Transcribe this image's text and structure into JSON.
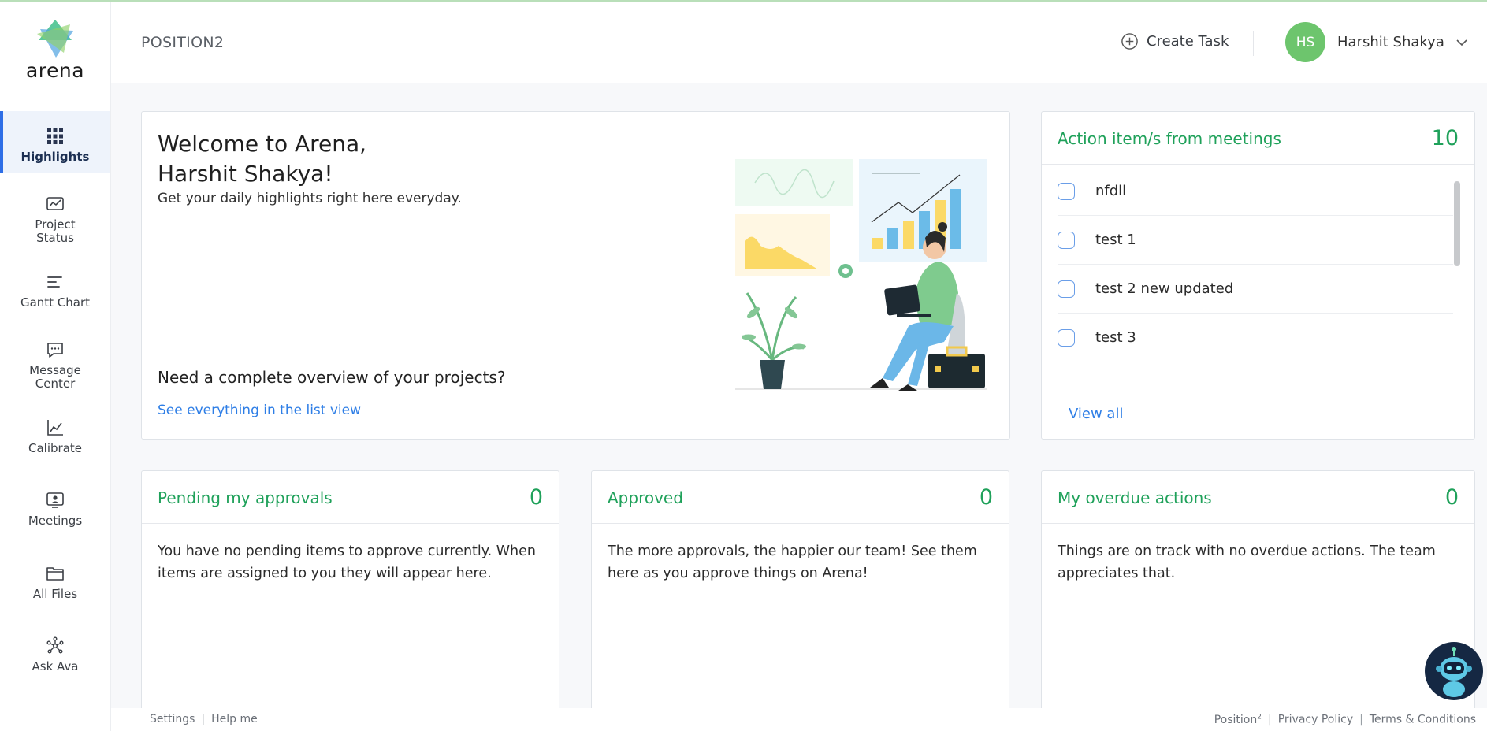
{
  "app": {
    "logo_text": "arena"
  },
  "sidebar": {
    "items": [
      {
        "label": "Highlights",
        "icon": "grid-icon",
        "active": true
      },
      {
        "label": "Project\nStatus",
        "icon": "chart-board-icon"
      },
      {
        "label": "Gantt Chart",
        "icon": "gantt-icon"
      },
      {
        "label": "Message\nCenter",
        "icon": "message-icon"
      },
      {
        "label": "Calibrate",
        "icon": "line-chart-icon"
      },
      {
        "label": "Meetings",
        "icon": "meeting-icon"
      },
      {
        "label": "All Files",
        "icon": "folder-icon"
      },
      {
        "label": "Ask Ava",
        "icon": "network-icon"
      }
    ]
  },
  "header": {
    "title": "POSITION2",
    "create_task": "Create Task",
    "user_initials": "HS",
    "user_name": "Harshit Shakya"
  },
  "welcome": {
    "line1": "Welcome to Arena,",
    "line2": "Harshit Shakya!",
    "subtitle": "Get your daily highlights right here everyday.",
    "question": "Need a complete overview of your projects?",
    "link": "See everything in the list view"
  },
  "action_items": {
    "title": "Action item/s from meetings",
    "count": "10",
    "items": [
      "nfdll",
      "test 1",
      "test 2 new updated",
      "test 3"
    ],
    "view_all": "View all"
  },
  "pending": {
    "title": "Pending my approvals",
    "count": "0",
    "body": "You have no pending items to approve currently. When items are assigned to you they will appear here."
  },
  "approved": {
    "title": "Approved",
    "count": "0",
    "body": "The more approvals, the happier our team! See them here as you approve things on Arena!"
  },
  "overdue": {
    "title": "My overdue actions",
    "count": "0",
    "body": "Things are on track with no overdue actions. The team appreciates that."
  },
  "footer": {
    "settings": "Settings",
    "help": "Help me",
    "position_brand": "Position",
    "position_sup": "2",
    "privacy": "Privacy Policy",
    "terms": "Terms & Conditions"
  },
  "colors": {
    "accent_green": "#1fa15a",
    "link_blue": "#2e7ee6",
    "avatar_green": "#6dc56d",
    "active_bar": "#2e6ee6"
  }
}
